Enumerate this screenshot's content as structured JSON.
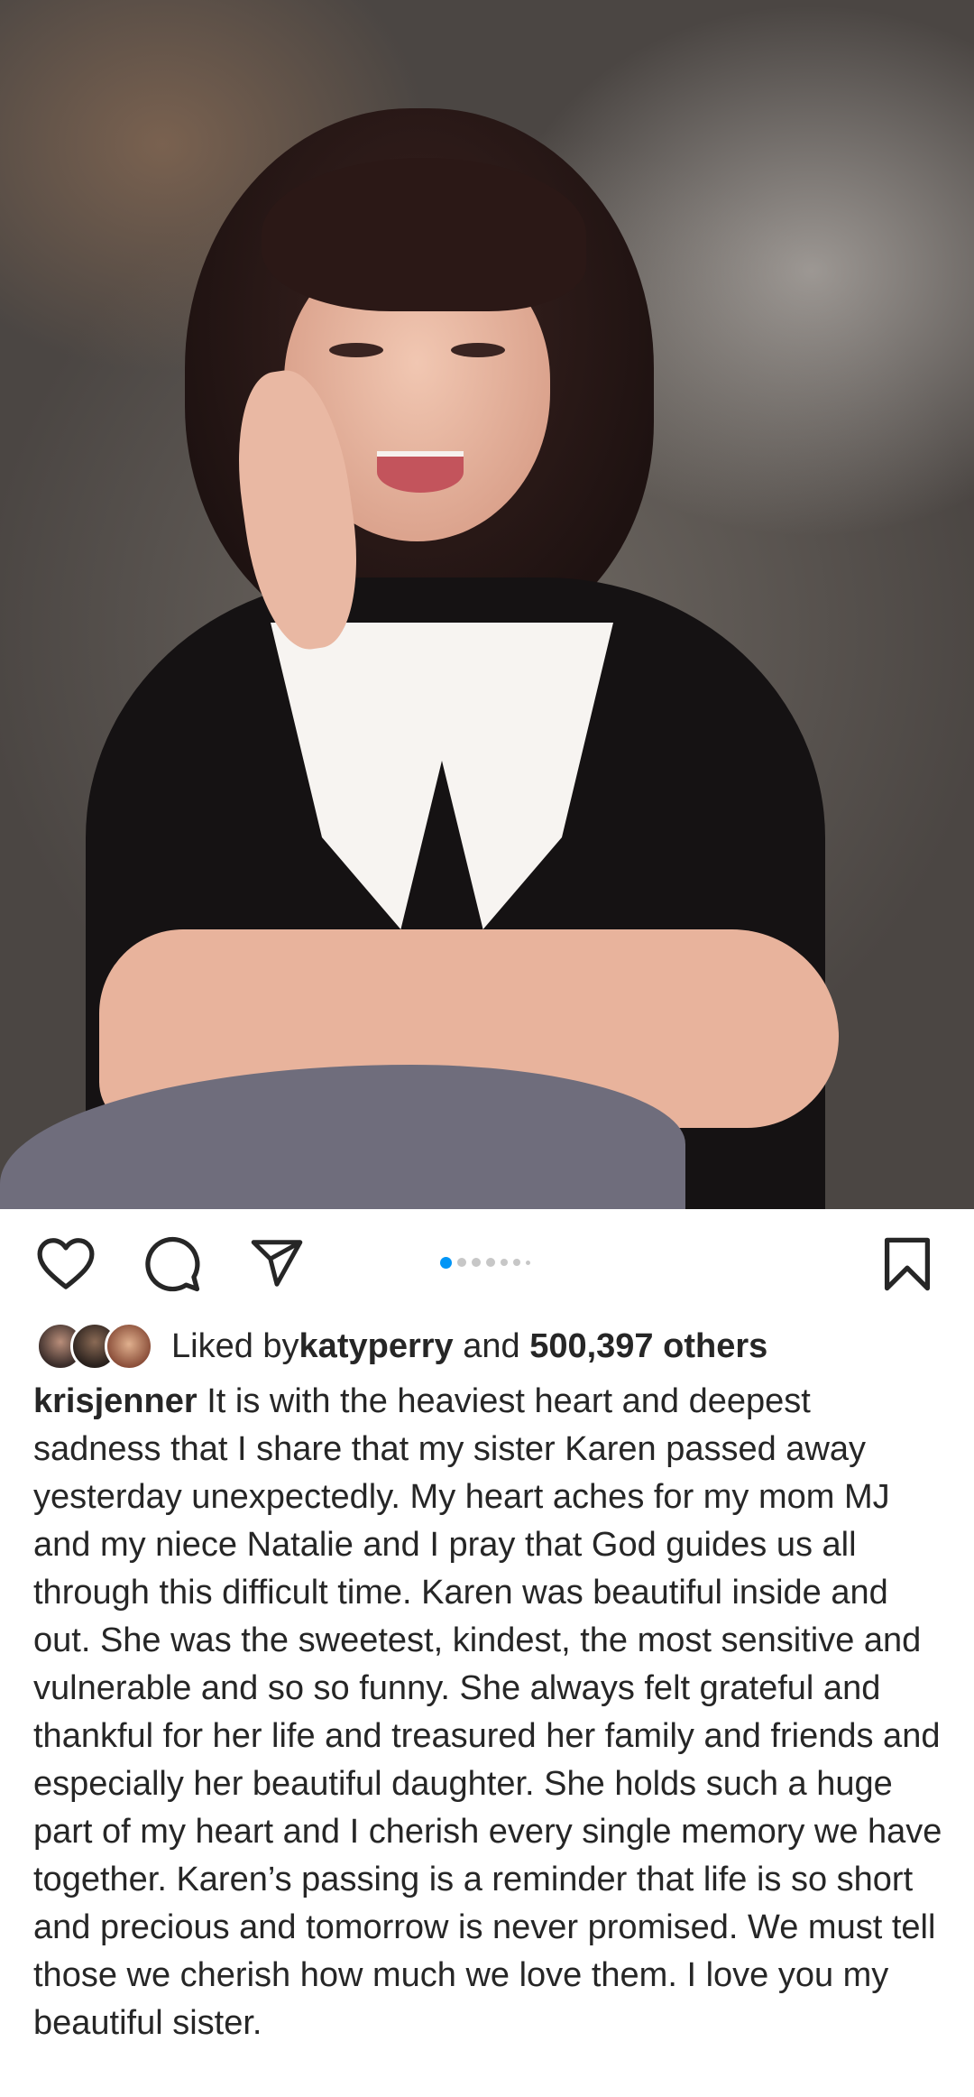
{
  "post": {
    "photo_alt": "Portrait photo of a smiling woman with dark hair",
    "carousel": {
      "count": 7,
      "active_index": 0
    }
  },
  "actions": {
    "like_icon": "heart-icon",
    "comment_icon": "comment-bubble-icon",
    "share_icon": "paper-plane-icon",
    "save_icon": "bookmark-icon"
  },
  "likes": {
    "prefix": "Liked by ",
    "user": "katyperry",
    "connector": " and ",
    "count_text": "500,397 others"
  },
  "caption": {
    "username": "krisjenner",
    "text": " It is with the heaviest heart and deepest sadness that I share that my sister Karen passed away yesterday unexpectedly. My heart aches for my mom MJ and my niece Natalie and I pray that God guides us all through this difficult time. Karen was beautiful inside and out. She was the sweetest, kindest, the most sensitive and vulnerable and so so funny. She always felt grateful and thankful for her life and treasured her family and friends and especially her beautiful daughter. She holds such a huge part of my heart and I cherish every single memory we have together. Karen’s passing is a reminder that life is so short and precious and tomorrow is never promised. We must tell those we cherish how much we love them. I love you my beautiful sister."
  },
  "colors": {
    "accent": "#0095f6",
    "text": "#262626",
    "dot_inactive": "#c7c7c7"
  }
}
